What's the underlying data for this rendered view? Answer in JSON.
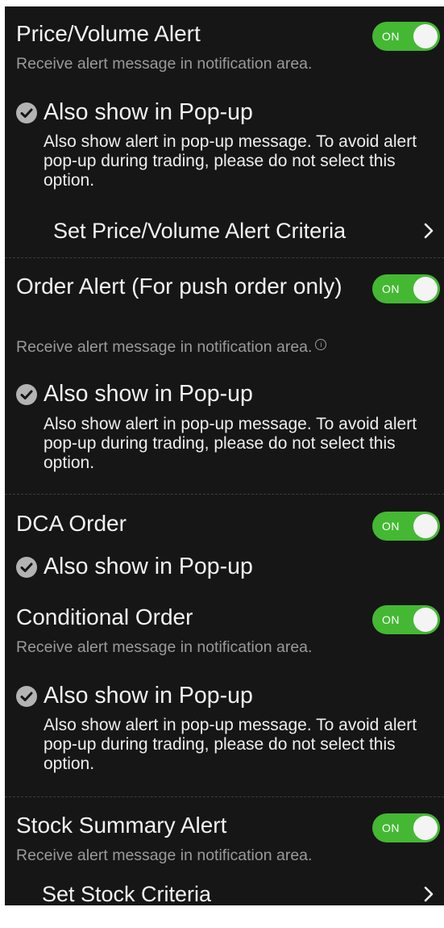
{
  "sections": [
    {
      "title": "Price/Volume Alert",
      "toggle": "ON",
      "subtitle": "Receive alert message in notification area.",
      "popup": {
        "label": "Also show in Pop-up",
        "description": "Also show alert in pop-up message. To avoid alert pop-up during trading, please do not select this option."
      },
      "link": "Set Price/Volume Alert Criteria"
    },
    {
      "title": "Order Alert (For push order only)",
      "toggle": "ON",
      "subtitle": "Receive alert message in notification area.",
      "info_icon": "info-icon",
      "popup": {
        "label": "Also show in Pop-up",
        "description": "Also show alert in pop-up message. To avoid alert pop-up during trading, please do not select this option."
      }
    },
    {
      "title": "DCA Order",
      "toggle": "ON",
      "popup": {
        "label": "Also show in Pop-up"
      }
    },
    {
      "title": "Conditional Order",
      "toggle": "ON",
      "subtitle": "Receive alert message in notification area.",
      "popup": {
        "label": "Also show in Pop-up",
        "description": "Also show alert in pop-up message. To avoid alert pop-up during trading, please do not select this option."
      }
    },
    {
      "title": "Stock Summary Alert",
      "toggle": "ON",
      "subtitle": "Receive alert message in notification area.",
      "link": "Set Stock Criteria"
    }
  ],
  "colors": {
    "background": "#161616",
    "toggle_on": "#44b833",
    "check_icon": "#b3b3b3",
    "subtitle_text": "#9a9a9a",
    "divider": "#3c3c3c"
  }
}
